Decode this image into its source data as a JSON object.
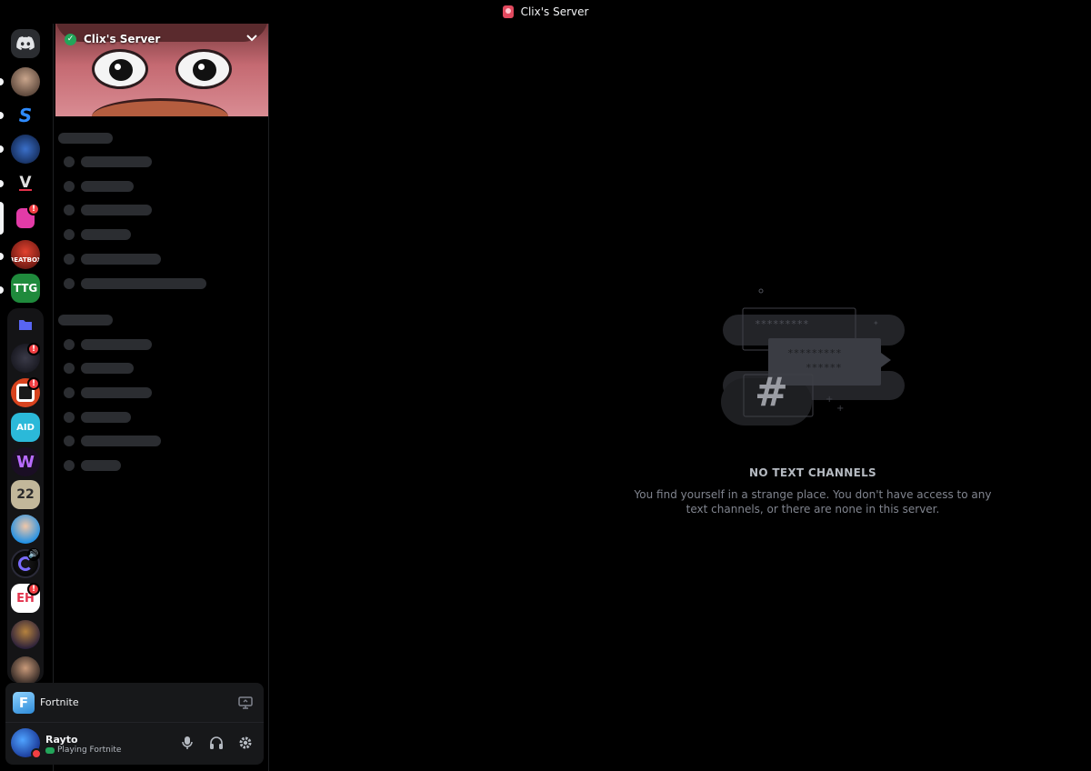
{
  "window": {
    "title": "Clix's Server"
  },
  "server": {
    "name": "Clix's Server",
    "verified": true
  },
  "rail": {
    "servers": [
      {
        "name": "discord-home",
        "badge": ""
      },
      {
        "name": "server-avatar-1",
        "badge": ""
      },
      {
        "name": "server-s",
        "badge": ""
      },
      {
        "name": "server-avatar-3",
        "badge": ""
      },
      {
        "name": "server-v",
        "badge": ""
      },
      {
        "name": "server-clix",
        "badge": "!"
      },
      {
        "name": "server-beatbox",
        "badge": ""
      },
      {
        "name": "server-ttg",
        "badge": ""
      },
      {
        "name": "server-folder",
        "badge": ""
      },
      {
        "name": "server-dark",
        "badge": "!"
      },
      {
        "name": "server-orange-v",
        "badge": "!"
      },
      {
        "name": "server-aid",
        "badge": ""
      },
      {
        "name": "server-w",
        "badge": ""
      },
      {
        "name": "server-22",
        "badge": ""
      },
      {
        "name": "server-person-blue",
        "badge": ""
      },
      {
        "name": "server-c",
        "badge": ""
      },
      {
        "name": "server-eh",
        "badge": "!"
      },
      {
        "name": "server-messi",
        "badge": ""
      },
      {
        "name": "server-person",
        "badge": ""
      }
    ],
    "labels": {
      "beatbox": "BEATBOX",
      "ttg": "TTG",
      "aid": "AID",
      "twentytwo": "22",
      "eh": "EH",
      "s": "S",
      "v": "V",
      "w": "W"
    }
  },
  "activity": {
    "game": "Fortnite",
    "game_letter": "F"
  },
  "user": {
    "name": "Rayto",
    "status_text": "Playing Fortnite"
  },
  "empty_state": {
    "title": "NO TEXT CHANNELS",
    "description": "You find yourself in a strange place. You don't have access to any text channels, or there are none in this server."
  },
  "colors": {
    "background": "#000000",
    "panel": "#17181a",
    "skeleton": "#2b2d31",
    "badge": "#f23f43",
    "online": "#23a55a",
    "dnd": "#f23f43"
  }
}
